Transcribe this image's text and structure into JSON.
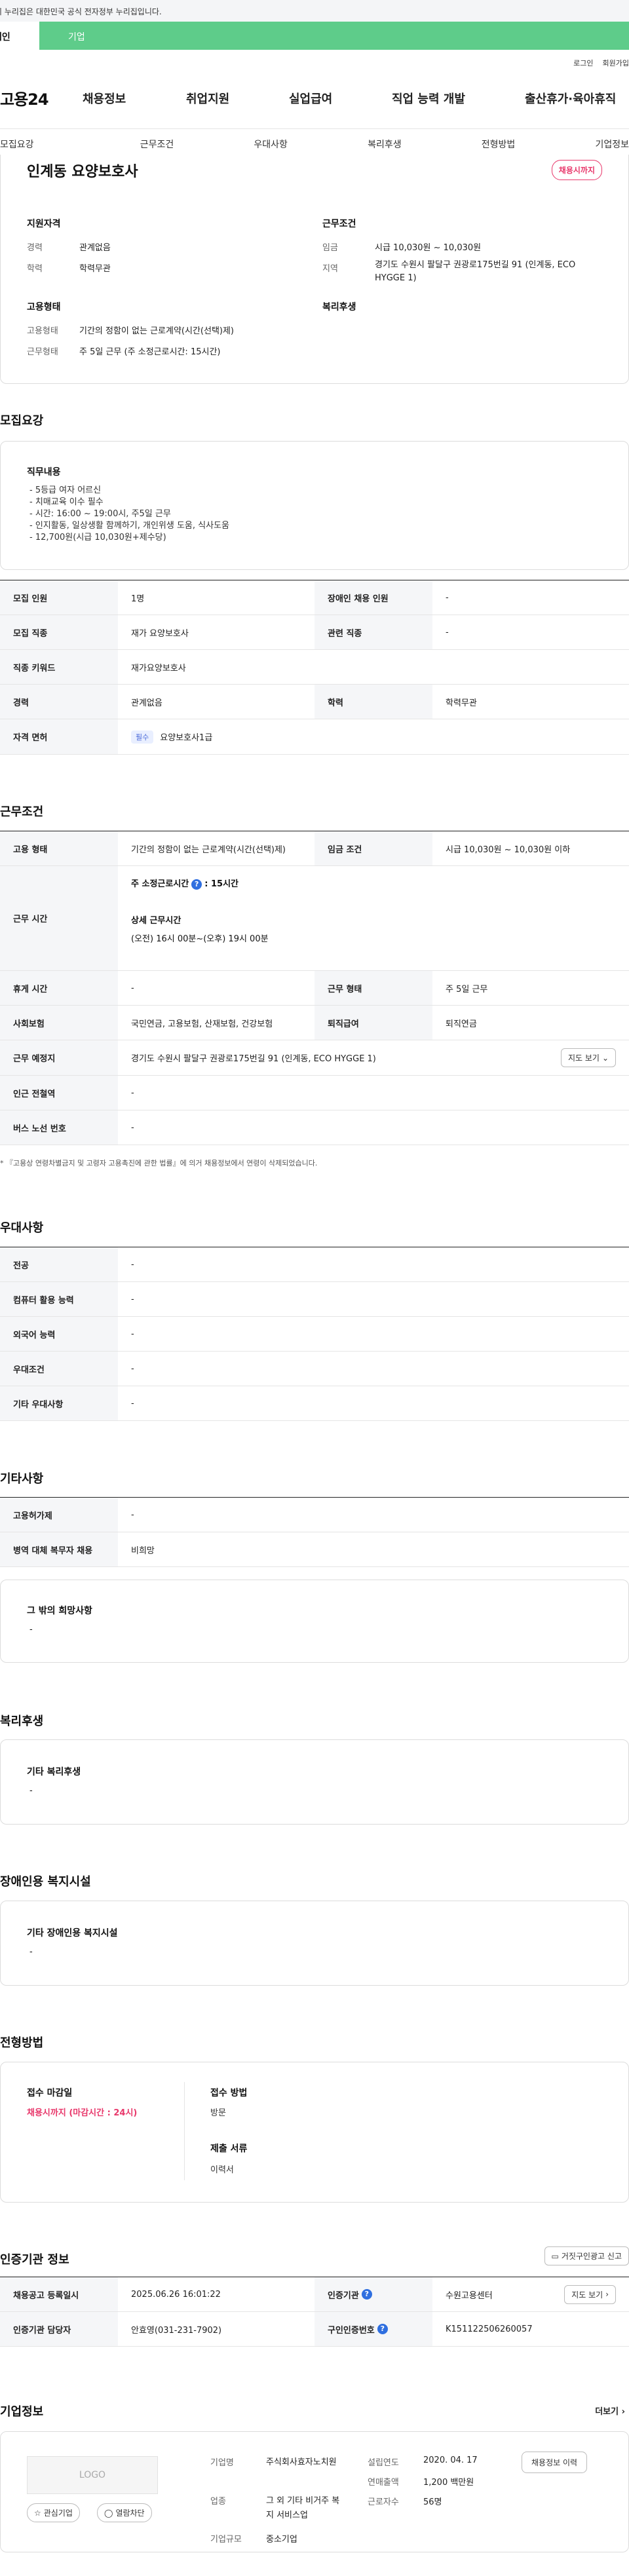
{
  "gov_bar": {
    "text": "이 누리집은 대한민국 공식 전자정부 누리집입니다."
  },
  "top_tabs": {
    "individual": "개인",
    "corporate": "기업"
  },
  "util_links": [
    "로그인",
    "회원가입"
  ],
  "header": {
    "logo": "고용24",
    "nav": [
      "채용정보",
      "취업지원",
      "실업급여",
      "직업 능력 개발",
      "출산휴가·육아휴직"
    ]
  },
  "subnav": [
    "모집요강",
    "근무조건",
    "우대사항",
    "복리후생",
    "전형방법",
    "기업정보"
  ],
  "summary": {
    "title": "인계동 요양보호사",
    "status_badge": "채용시까지",
    "qual_heading": "지원자격",
    "career_label": "경력",
    "career_value": "관계없음",
    "edu_label": "학력",
    "edu_value": "학력무관",
    "emp_heading": "고용형태",
    "emp_type_label": "고용형태",
    "emp_type_value": "기간의 정함이 없는 근로계약(시간(선택)제)",
    "work_form_label": "근무형태",
    "work_form_value": "주 5일 근무 (주 소정근로시간: 15시간)",
    "cond_heading": "근무조건",
    "wage_label": "임금",
    "wage_value": "시급 10,030원 ~ 10,030원",
    "region_label": "지역",
    "region_value": "경기도 수원시 팔달구 권광로175번길 91 (인계동, ECO HYGGE 1)",
    "welfare_heading": "복리후생"
  },
  "recruit": {
    "heading": "모집요강",
    "job_desc_heading": "직무내용",
    "job_desc_lines": [
      "- 5등급 여자 어르신",
      "- 치매교육 이수 필수",
      "- 시간:  16:00 ~ 19:00시,   주5일 근무",
      "- 인지활동, 일상생활 함께하기, 개인위생 도움, 식사도움",
      "- 12,700원(시급 10,030원+제수당)"
    ],
    "rows": [
      {
        "k1": "모집 인원",
        "v1": "1명",
        "k2": "장애인 채용 인원",
        "v2": "-"
      },
      {
        "k1": "모집 직종",
        "v1": "재가 요양보호사",
        "k2": "관련 직종",
        "v2": "-"
      },
      {
        "k1": "직종 키워드",
        "v1": "재가요양보호사"
      },
      {
        "k1": "경력",
        "v1": "관계없음",
        "k2": "학력",
        "v2": "학력무관"
      }
    ],
    "license_label": "자격 면허",
    "license_chip": "필수",
    "license_value": "요양보호사1급"
  },
  "conditions": {
    "heading": "근무조건",
    "emp_type_label": "고용 형태",
    "emp_type_value": "기간의 정함이 없는 근로계약(시간(선택)제)",
    "wage_label": "임금 조건",
    "wage_value": "시급 10,030원 ~ 10,030원 이하",
    "work_time_label": "근무 시간",
    "weekly_hours_label": "주 소정근로시간",
    "weekly_hours_value": ": 15시간",
    "detail_time_label": "상세 근무시간",
    "detail_time_value": "(오전) 16시 00분~(오후) 19시 00분",
    "rest_label": "휴게 시간",
    "rest_value": "-",
    "work_form_label": "근무 형태",
    "work_form_value": "주 5일 근무",
    "insurance_label": "사회보험",
    "insurance_value": "국민연금, 고용보험, 산재보험, 건강보험",
    "retire_label": "퇴직급여",
    "retire_value": "퇴직연금",
    "location_label": "근무 예정지",
    "location_value": "경기도 수원시 팔달구 권광로175번길 91 (인계동, ECO HYGGE 1)",
    "map_button": "지도 보기",
    "subway_label": "인근 전철역",
    "subway_value": "-",
    "bus_label": "버스 노선 번호",
    "bus_value": "-",
    "note": "* 『고용상 연령차별금지 및 고령자 고용촉진에 관한 법률』에 의거 채용정보에서 연령이 삭제되었습니다."
  },
  "preference": {
    "heading": "우대사항",
    "rows": [
      {
        "k": "전공",
        "v": "-"
      },
      {
        "k": "컴퓨터 활용 능력",
        "v": "-"
      },
      {
        "k": "외국어 능력",
        "v": "-"
      },
      {
        "k": "우대조건",
        "v": "-"
      },
      {
        "k": "기타 우대사항",
        "v": "-"
      }
    ]
  },
  "etc": {
    "heading": "기타사항",
    "rows": [
      {
        "k": "고용허가제",
        "v": "-"
      },
      {
        "k": "병역 대체 복무자 채용",
        "v": "비희망"
      }
    ],
    "other_heading": "그 밖의 희망사항",
    "other_value": "-"
  },
  "welfare": {
    "heading": "복리후생",
    "box_heading": "기타 복리후생",
    "box_value": "-"
  },
  "disability": {
    "heading": "장애인용 복지시설",
    "box_heading": "기타 장애인용 복지시설",
    "box_value": "-"
  },
  "selection": {
    "heading": "전형방법",
    "deadline_label": "접수 마감일",
    "deadline_value": "채용시까지 (마감시간 : 24시)",
    "method_label": "접수 방법",
    "method_value": "방문",
    "docs_label": "제출 서류",
    "docs_value": "이력서"
  },
  "agency": {
    "heading": "인증기관 정보",
    "report_button": "거짓구인광고 신고",
    "reg_date_label": "채용공고 등록일시",
    "reg_date_value": "2025.06.26 16:01:22",
    "org_label": "인증기관",
    "org_value": "수원고용센터",
    "map_button": "지도 보기",
    "manager_label": "인증기관 담당자",
    "manager_value": "안효영(031-231-7902)",
    "job_no_label": "구인인증번호",
    "job_no_value": "K151122506260057"
  },
  "company": {
    "heading": "기업정보",
    "more": "더보기",
    "logo_placeholder": "LOGO",
    "interest_button": "관심기업",
    "block_button": "열람차단",
    "name_label": "기업명",
    "name_value": "주식회사효자노치원",
    "industry_label": "업종",
    "industry_value": "그 외 기타 비거주 복지 서비스업",
    "size_label": "기업규모",
    "size_value": "중소기업",
    "founded_label": "설립연도",
    "founded_value": "2020. 04. 17",
    "sales_label": "연매출액",
    "sales_value": "1,200 백만원",
    "employees_label": "근로자수",
    "employees_value": "56명",
    "jobs_button": "채용정보 이력"
  }
}
